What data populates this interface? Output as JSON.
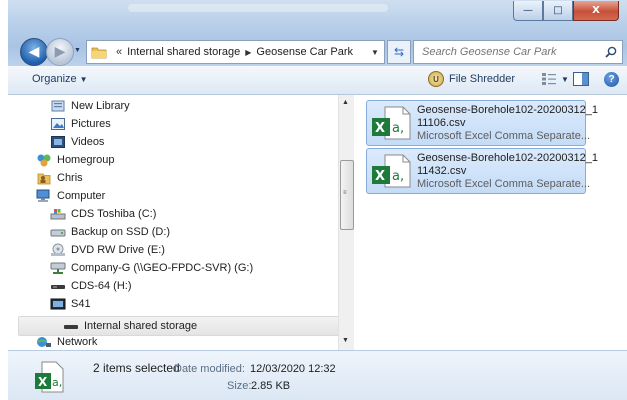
{
  "window": {
    "controls": {
      "minimize": "—",
      "maximize": "□",
      "close": "X"
    }
  },
  "address": {
    "overflow": "«",
    "separator": "▶",
    "crumbs": [
      "Internal shared storage",
      "Geosense Car Park"
    ],
    "search_placeholder": "Search Geosense Car Park"
  },
  "toolbar": {
    "organize": "Organize",
    "file_shredder": "File Shredder",
    "shredder_badge": "U"
  },
  "navpane": {
    "items": [
      {
        "label": "New Library",
        "icon": "library-icon"
      },
      {
        "label": "Pictures",
        "icon": "pictures-icon"
      },
      {
        "label": "Videos",
        "icon": "videos-icon"
      },
      {
        "label": "Homegroup",
        "icon": "homegroup-icon"
      },
      {
        "label": "Chris",
        "icon": "user-folder-icon"
      },
      {
        "label": "Computer",
        "icon": "computer-icon"
      },
      {
        "label": "CDS Toshiba (C:)",
        "icon": "system-drive-icon"
      },
      {
        "label": "Backup on SSD (D:)",
        "icon": "drive-icon"
      },
      {
        "label": "DVD RW Drive (E:)",
        "icon": "dvd-drive-icon"
      },
      {
        "label": "Company-G (\\\\GEO-FPDC-SVR) (G:)",
        "icon": "network-drive-icon"
      },
      {
        "label": "CDS-64 (H:)",
        "icon": "removable-drive-icon"
      },
      {
        "label": "S41",
        "icon": "phone-icon"
      },
      {
        "label": "Internal shared storage",
        "icon": "storage-icon",
        "selected": true
      },
      {
        "label": "Network",
        "icon": "network-icon"
      }
    ]
  },
  "files": [
    {
      "name_line1": "Geosense-Borehole102-20200312_1",
      "name_line2": "11106.csv",
      "type": "Microsoft Excel Comma Separate..."
    },
    {
      "name_line1": "Geosense-Borehole102-20200312_1",
      "name_line2": "11432.csv",
      "type": "Microsoft Excel Comma Separate..."
    }
  ],
  "details": {
    "count": "2 items selected",
    "date_modified_label": "Date modified:",
    "date_modified": "12/03/2020 12:32",
    "size_label": "Size:",
    "size": "2.85 KB"
  },
  "colors": {
    "accent": "#1f5fae",
    "selection": "#cde3f8",
    "excel_green": "#1d7a3a"
  }
}
